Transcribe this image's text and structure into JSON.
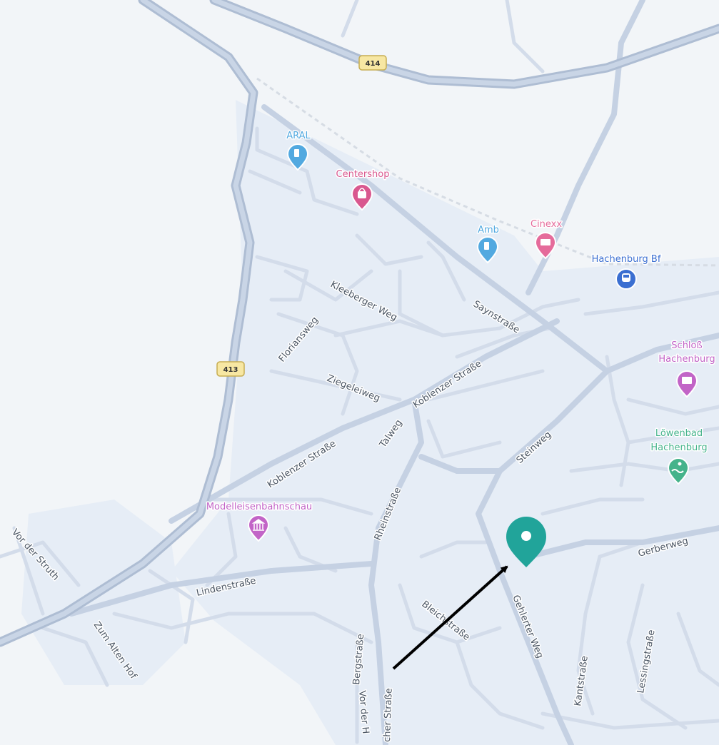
{
  "map": {
    "route_shields": [
      "414",
      "413"
    ],
    "pois": [
      {
        "label": "ARAL",
        "icon": "fuel-icon",
        "color": "#52a9e0"
      },
      {
        "label": "Centershop",
        "icon": "shopping-bag-icon",
        "color": "#d9588f"
      },
      {
        "label": "Amb",
        "icon": "fuel-icon",
        "color": "#52a9e0"
      },
      {
        "label": "Cinexx",
        "icon": "cinema-icon",
        "color": "#e56b9b"
      },
      {
        "label": "Hachenburg Bf",
        "icon": "train-station-icon",
        "color": "#3b6fd1"
      },
      {
        "label_lines": [
          "Schloß",
          "Hachenburg"
        ],
        "icon": "castle-icon",
        "color": "#c264c7"
      },
      {
        "label_lines": [
          "Löwenbad",
          "Hachenburg"
        ],
        "icon": "swimming-pool-icon",
        "color": "#45b38b"
      },
      {
        "label": "Modelleisenbahnschau",
        "icon": "museum-icon",
        "color": "#c264c7"
      }
    ],
    "streets": [
      "Kleeberger Weg",
      "Saynstraße",
      "Floriansweg",
      "Koblenzer Straße",
      "Ziegeleiweg",
      "Koblenzer Straße",
      "Talweg",
      "Steinweg",
      "Rheinstraße",
      "Vor der Struth",
      "Lindenstraße",
      "Gerberweg",
      "Zum Alten Hof",
      "Bleichstraße",
      "Gehlerter Weg",
      "Bergstraße",
      "Vor der H",
      "cher Straße",
      "Kantstraße",
      "Lessingstraße"
    ],
    "marker": {
      "icon": "location-pin-icon",
      "color": "#21a49a"
    },
    "annotation": {
      "icon": "arrow-icon",
      "color": "#000000"
    }
  }
}
